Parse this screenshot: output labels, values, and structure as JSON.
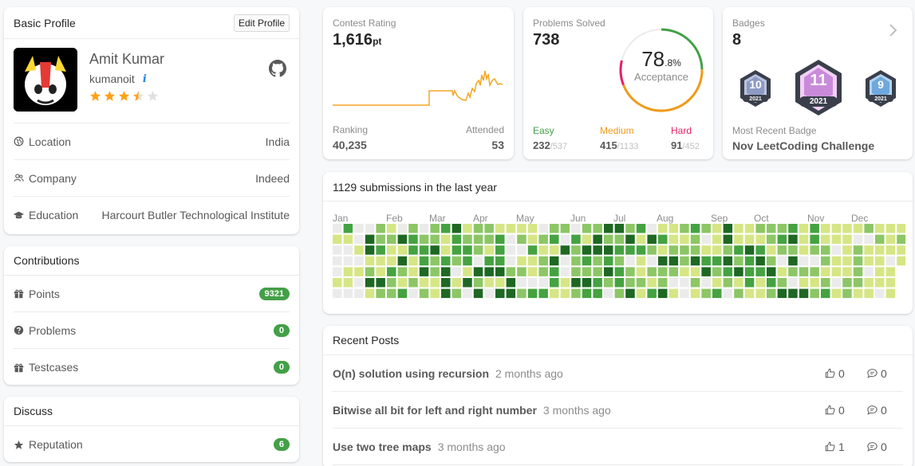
{
  "profile": {
    "header": "Basic Profile",
    "edit_label": "Edit Profile",
    "name": "Amit Kumar",
    "username": "kumanoit",
    "info_glyph": "i",
    "stars": 3.5,
    "avatar_icon": "avatar-icon",
    "github_icon": "github-icon",
    "rows": [
      {
        "label": "Location",
        "value": "India",
        "icon": "globe-icon"
      },
      {
        "label": "Company",
        "value": "Indeed",
        "icon": "people-icon"
      },
      {
        "label": "Education",
        "value": "Harcourt Butler Technological Institute",
        "icon": "graduation-cap-icon"
      }
    ]
  },
  "contributions": {
    "header": "Contributions",
    "rows": [
      {
        "label": "Points",
        "value": "9321",
        "icon": "gift-icon"
      },
      {
        "label": "Problems",
        "value": "0",
        "icon": "question-icon"
      },
      {
        "label": "Testcases",
        "value": "0",
        "icon": "gift-icon"
      }
    ]
  },
  "discuss": {
    "header": "Discuss",
    "rows": [
      {
        "label": "Reputation",
        "value": "6",
        "icon": "star-icon"
      }
    ]
  },
  "contest": {
    "title": "Contest Rating",
    "rating": "1,616",
    "unit": "pt",
    "ranking_label": "Ranking",
    "ranking_value": "40,235",
    "attended_label": "Attended",
    "attended_value": "53",
    "line_color": "#f5a623"
  },
  "solved": {
    "title": "Problems Solved",
    "total": "738",
    "percent_int": "78",
    "percent_dec": ".8%",
    "acceptance_label": "Acceptance",
    "acceptance_fraction": 0.788,
    "easy": {
      "label": "Easy",
      "solved": "232",
      "total": "/537",
      "color": "#43a047"
    },
    "medium": {
      "label": "Medium",
      "solved": "415",
      "total": "/1133",
      "color": "#ef9a19"
    },
    "hard": {
      "label": "Hard",
      "solved": "91",
      "total": "/452",
      "color": "#e91e63"
    }
  },
  "badges": {
    "title": "Badges",
    "count": "8",
    "recent_label": "Most Recent Badge",
    "recent_name": "Nov LeetCoding Challenge",
    "items": [
      {
        "num": "10",
        "year": "2021"
      },
      {
        "num": "11",
        "year": "2021"
      },
      {
        "num": "9",
        "year": "2021"
      }
    ]
  },
  "heatmap": {
    "title": "1129 submissions in the last year",
    "months": [
      "Jan",
      "Feb",
      "Mar",
      "Apr",
      "May",
      "Jun",
      "Jul",
      "Aug",
      "Sep",
      "Oct",
      "Nov",
      "Dec"
    ],
    "colors": [
      "#ebebeb",
      "#d6e685",
      "#8cc665",
      "#44a340",
      "#1e6823"
    ]
  },
  "posts": {
    "header": "Recent Posts",
    "items": [
      {
        "title": "O(n) solution using recursion",
        "time": "2 months ago",
        "likes": "0",
        "comments": "0"
      },
      {
        "title": "Bitwise all bit for left and right number",
        "time": "3 months ago",
        "likes": "0",
        "comments": "0"
      },
      {
        "title": "Use two tree maps",
        "time": "3 months ago",
        "likes": "1",
        "comments": "0"
      }
    ]
  }
}
